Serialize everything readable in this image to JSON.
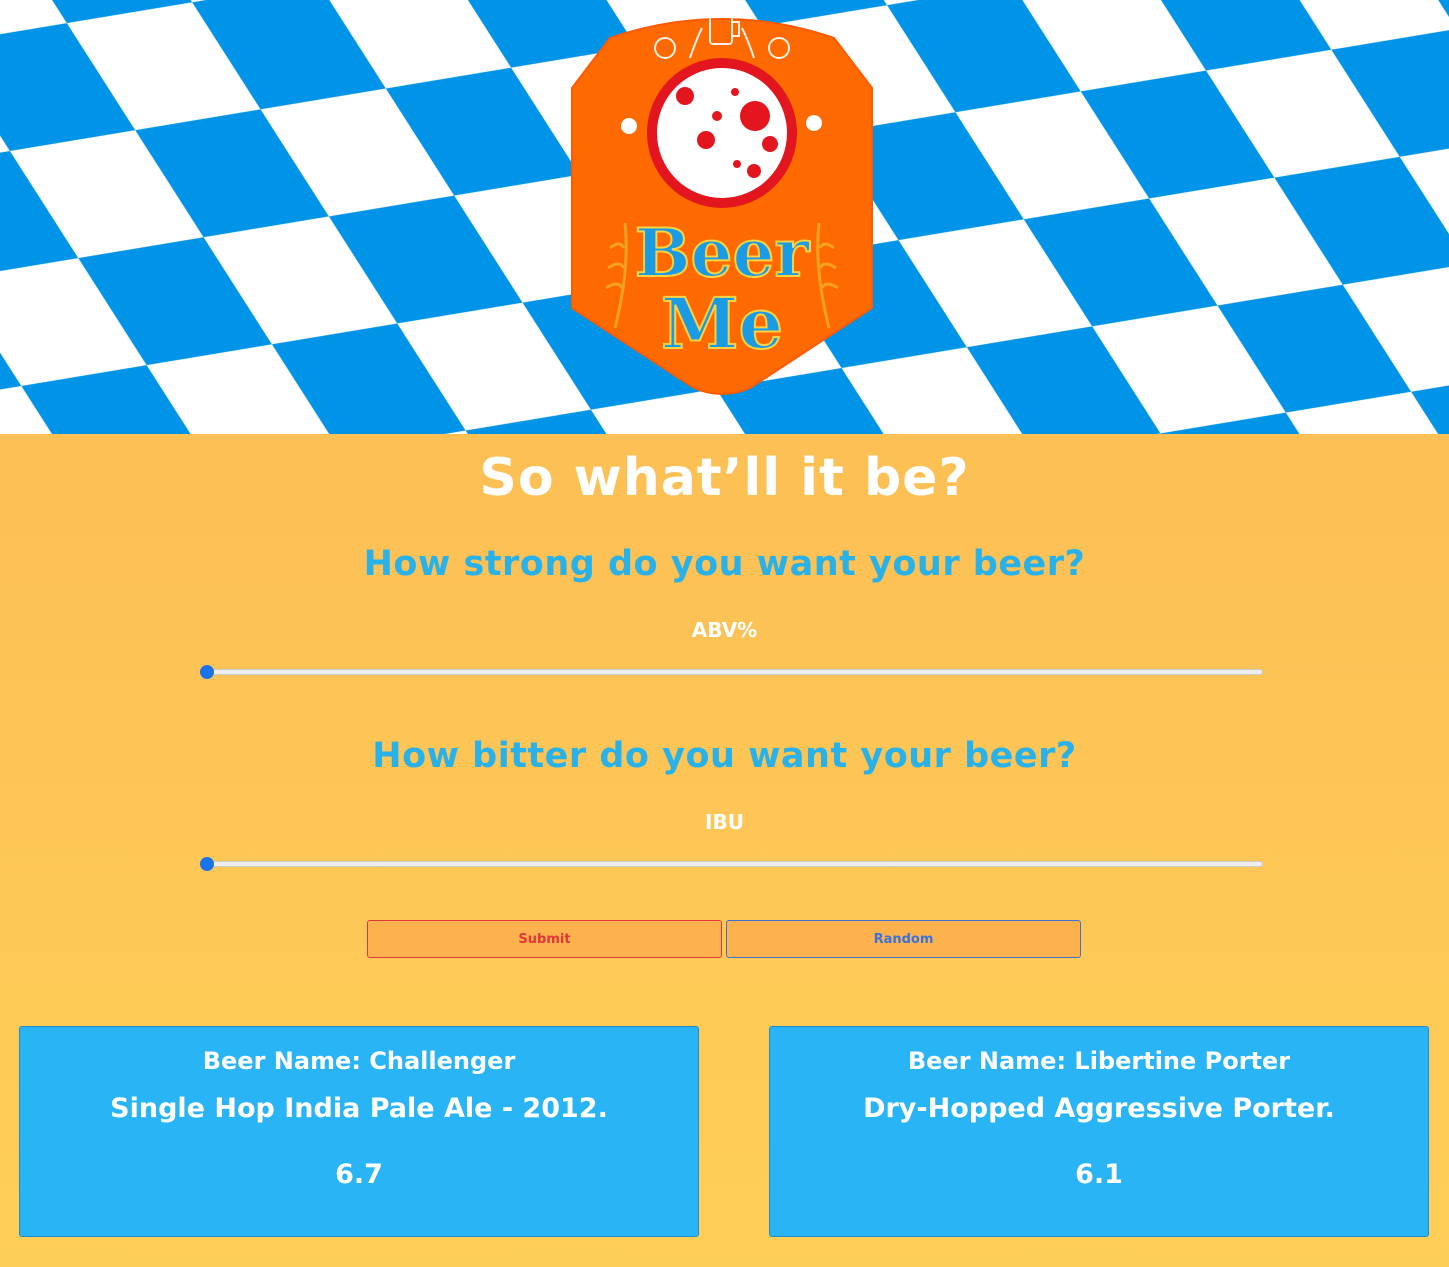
{
  "logo": {
    "text_line1": "Beer",
    "text_line2": "Me"
  },
  "colors": {
    "flag_blue": "#0094e8",
    "badge_orange": "#ff6a00",
    "accent_blue": "#29b1ea",
    "submit_red": "#e2383c",
    "random_blue": "#3b72d8"
  },
  "heading": "So what’ll it be?",
  "abv_section": {
    "question": "How strong do you want your beer?",
    "label": "ABV%",
    "value": 0
  },
  "ibu_section": {
    "question": "How bitter do you want your beer?",
    "label": "IBU",
    "value": 0
  },
  "buttons": {
    "submit": "Submit",
    "random": "Random"
  },
  "results": [
    {
      "name": "Beer Name: Challenger",
      "description": "Single Hop India Pale Ale - 2012.",
      "abv": "6.7"
    },
    {
      "name": "Beer Name: Libertine Porter",
      "description": "Dry-Hopped Aggressive Porter.",
      "abv": "6.1"
    }
  ]
}
